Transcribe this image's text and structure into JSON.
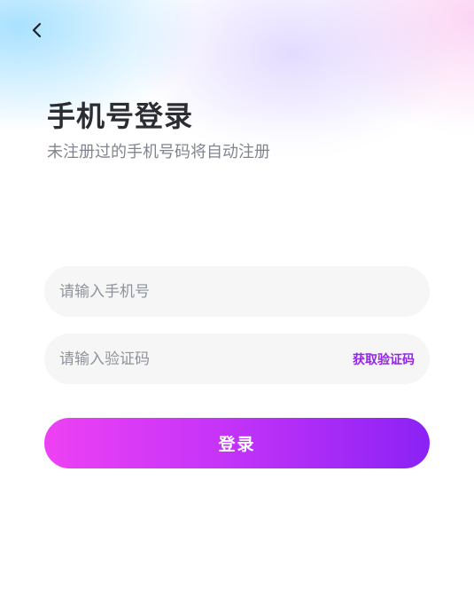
{
  "header": {
    "back_icon": "chevron-left-icon",
    "title": "手机号登录",
    "subtitle": "未注册过的手机号码将自动注册"
  },
  "form": {
    "phone": {
      "value": "",
      "placeholder": "请输入手机号"
    },
    "code": {
      "value": "",
      "placeholder": "请输入验证码",
      "get_code_label": "获取验证码"
    },
    "login_label": "登录"
  },
  "colors": {
    "title": "#2b2d33",
    "subtitle": "#808591",
    "field_background": "#f6f6f7",
    "accent": "#9526e6",
    "button_gradient_start": "#ee41f4",
    "button_gradient_end": "#8b22f5"
  }
}
